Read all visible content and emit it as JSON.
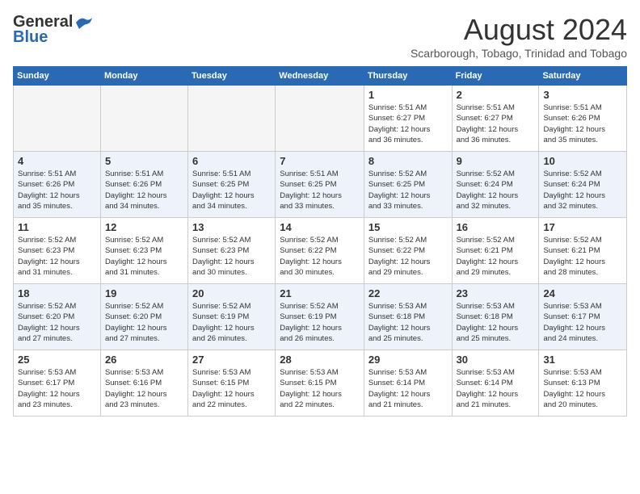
{
  "logo": {
    "general": "General",
    "blue": "Blue"
  },
  "title": {
    "month_year": "August 2024",
    "location": "Scarborough, Tobago, Trinidad and Tobago"
  },
  "weekdays": [
    "Sunday",
    "Monday",
    "Tuesday",
    "Wednesday",
    "Thursday",
    "Friday",
    "Saturday"
  ],
  "weeks": [
    [
      {
        "day": "",
        "info": ""
      },
      {
        "day": "",
        "info": ""
      },
      {
        "day": "",
        "info": ""
      },
      {
        "day": "",
        "info": ""
      },
      {
        "day": "1",
        "info": "Sunrise: 5:51 AM\nSunset: 6:27 PM\nDaylight: 12 hours\nand 36 minutes."
      },
      {
        "day": "2",
        "info": "Sunrise: 5:51 AM\nSunset: 6:27 PM\nDaylight: 12 hours\nand 36 minutes."
      },
      {
        "day": "3",
        "info": "Sunrise: 5:51 AM\nSunset: 6:26 PM\nDaylight: 12 hours\nand 35 minutes."
      }
    ],
    [
      {
        "day": "4",
        "info": "Sunrise: 5:51 AM\nSunset: 6:26 PM\nDaylight: 12 hours\nand 35 minutes."
      },
      {
        "day": "5",
        "info": "Sunrise: 5:51 AM\nSunset: 6:26 PM\nDaylight: 12 hours\nand 34 minutes."
      },
      {
        "day": "6",
        "info": "Sunrise: 5:51 AM\nSunset: 6:25 PM\nDaylight: 12 hours\nand 34 minutes."
      },
      {
        "day": "7",
        "info": "Sunrise: 5:51 AM\nSunset: 6:25 PM\nDaylight: 12 hours\nand 33 minutes."
      },
      {
        "day": "8",
        "info": "Sunrise: 5:52 AM\nSunset: 6:25 PM\nDaylight: 12 hours\nand 33 minutes."
      },
      {
        "day": "9",
        "info": "Sunrise: 5:52 AM\nSunset: 6:24 PM\nDaylight: 12 hours\nand 32 minutes."
      },
      {
        "day": "10",
        "info": "Sunrise: 5:52 AM\nSunset: 6:24 PM\nDaylight: 12 hours\nand 32 minutes."
      }
    ],
    [
      {
        "day": "11",
        "info": "Sunrise: 5:52 AM\nSunset: 6:23 PM\nDaylight: 12 hours\nand 31 minutes."
      },
      {
        "day": "12",
        "info": "Sunrise: 5:52 AM\nSunset: 6:23 PM\nDaylight: 12 hours\nand 31 minutes."
      },
      {
        "day": "13",
        "info": "Sunrise: 5:52 AM\nSunset: 6:23 PM\nDaylight: 12 hours\nand 30 minutes."
      },
      {
        "day": "14",
        "info": "Sunrise: 5:52 AM\nSunset: 6:22 PM\nDaylight: 12 hours\nand 30 minutes."
      },
      {
        "day": "15",
        "info": "Sunrise: 5:52 AM\nSunset: 6:22 PM\nDaylight: 12 hours\nand 29 minutes."
      },
      {
        "day": "16",
        "info": "Sunrise: 5:52 AM\nSunset: 6:21 PM\nDaylight: 12 hours\nand 29 minutes."
      },
      {
        "day": "17",
        "info": "Sunrise: 5:52 AM\nSunset: 6:21 PM\nDaylight: 12 hours\nand 28 minutes."
      }
    ],
    [
      {
        "day": "18",
        "info": "Sunrise: 5:52 AM\nSunset: 6:20 PM\nDaylight: 12 hours\nand 27 minutes."
      },
      {
        "day": "19",
        "info": "Sunrise: 5:52 AM\nSunset: 6:20 PM\nDaylight: 12 hours\nand 27 minutes."
      },
      {
        "day": "20",
        "info": "Sunrise: 5:52 AM\nSunset: 6:19 PM\nDaylight: 12 hours\nand 26 minutes."
      },
      {
        "day": "21",
        "info": "Sunrise: 5:52 AM\nSunset: 6:19 PM\nDaylight: 12 hours\nand 26 minutes."
      },
      {
        "day": "22",
        "info": "Sunrise: 5:53 AM\nSunset: 6:18 PM\nDaylight: 12 hours\nand 25 minutes."
      },
      {
        "day": "23",
        "info": "Sunrise: 5:53 AM\nSunset: 6:18 PM\nDaylight: 12 hours\nand 25 minutes."
      },
      {
        "day": "24",
        "info": "Sunrise: 5:53 AM\nSunset: 6:17 PM\nDaylight: 12 hours\nand 24 minutes."
      }
    ],
    [
      {
        "day": "25",
        "info": "Sunrise: 5:53 AM\nSunset: 6:17 PM\nDaylight: 12 hours\nand 23 minutes."
      },
      {
        "day": "26",
        "info": "Sunrise: 5:53 AM\nSunset: 6:16 PM\nDaylight: 12 hours\nand 23 minutes."
      },
      {
        "day": "27",
        "info": "Sunrise: 5:53 AM\nSunset: 6:15 PM\nDaylight: 12 hours\nand 22 minutes."
      },
      {
        "day": "28",
        "info": "Sunrise: 5:53 AM\nSunset: 6:15 PM\nDaylight: 12 hours\nand 22 minutes."
      },
      {
        "day": "29",
        "info": "Sunrise: 5:53 AM\nSunset: 6:14 PM\nDaylight: 12 hours\nand 21 minutes."
      },
      {
        "day": "30",
        "info": "Sunrise: 5:53 AM\nSunset: 6:14 PM\nDaylight: 12 hours\nand 21 minutes."
      },
      {
        "day": "31",
        "info": "Sunrise: 5:53 AM\nSunset: 6:13 PM\nDaylight: 12 hours\nand 20 minutes."
      }
    ]
  ]
}
